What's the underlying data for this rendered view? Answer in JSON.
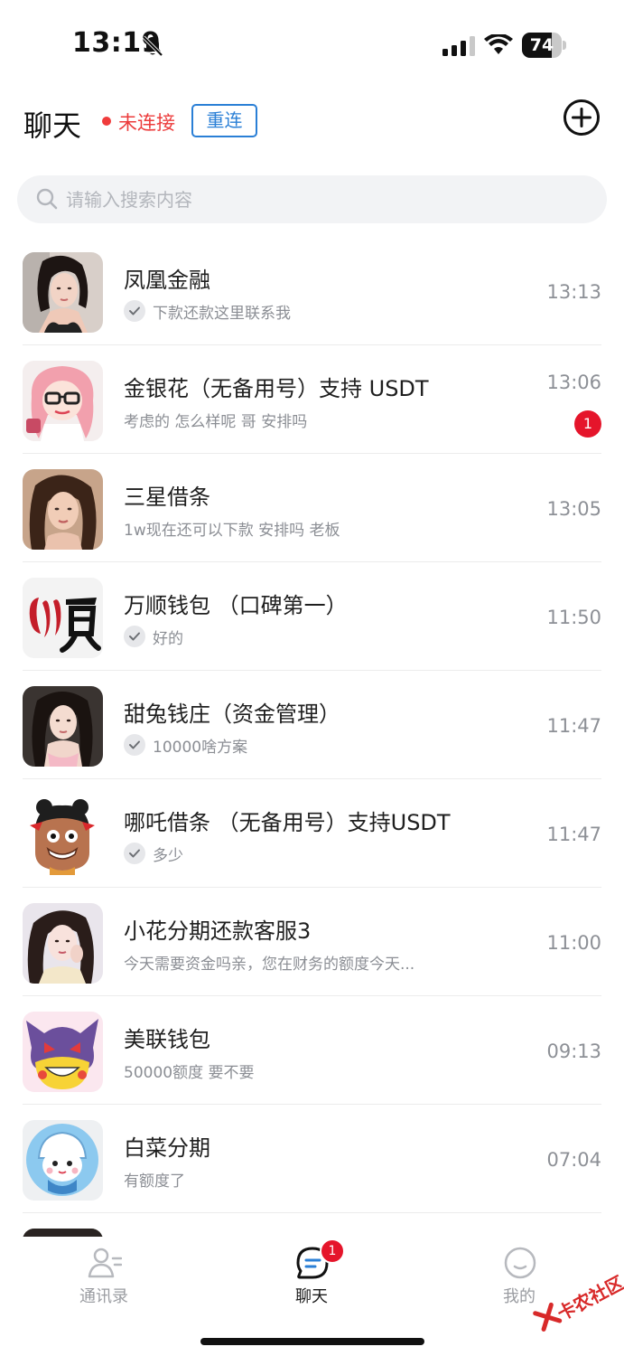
{
  "status_bar": {
    "time": "13:19",
    "battery": "74",
    "battery_level": 0.74,
    "icons": [
      "bell-off-icon",
      "signal-icon",
      "wifi-icon",
      "battery-icon"
    ]
  },
  "header": {
    "title": "聊天",
    "connection_status": "未连接",
    "reconnect_label": "重连",
    "add_icon": "plus-circle-icon"
  },
  "search": {
    "placeholder": "请输入搜索内容"
  },
  "chats": [
    {
      "name": "凤凰金融",
      "preview": "下款还款这里联系我",
      "time": "13:13",
      "read_check": true,
      "unread": ""
    },
    {
      "name": "金银花（无备用号）支持 USDT",
      "preview": "考虑的 怎么样呢 哥 安排吗",
      "time": "13:06",
      "read_check": false,
      "unread": "1"
    },
    {
      "name": "三星借条",
      "preview": "1w现在还可以下款 安排吗 老板",
      "time": "13:05",
      "read_check": false,
      "unread": ""
    },
    {
      "name": "万顺钱包 （口碑第一）",
      "preview": "好的",
      "time": "11:50",
      "read_check": true,
      "unread": ""
    },
    {
      "name": "甜兔钱庄（资金管理）",
      "preview": "10000啥方案",
      "time": "11:47",
      "read_check": true,
      "unread": ""
    },
    {
      "name": "哪吒借条 （无备用号）支持USDT",
      "preview": "多少",
      "time": "11:47",
      "read_check": true,
      "unread": ""
    },
    {
      "name": "小花分期还款客服3",
      "preview": "今天需要资金吗亲，您在财务的额度今天...",
      "time": "11:00",
      "read_check": false,
      "unread": ""
    },
    {
      "name": "美联钱包",
      "preview": "50000额度 要不要",
      "time": "09:13",
      "read_check": false,
      "unread": ""
    },
    {
      "name": "白菜分期",
      "preview": "有额度了",
      "time": "07:04",
      "read_check": false,
      "unread": ""
    }
  ],
  "avatar_text": {
    "wanshun_logo": "顺"
  },
  "tabs": [
    {
      "label": "通讯录",
      "icon": "contacts-icon",
      "active": false
    },
    {
      "label": "聊天",
      "icon": "chat-icon",
      "active": true,
      "badge": "1"
    },
    {
      "label": "我的",
      "icon": "profile-icon",
      "active": false
    }
  ],
  "watermark": "卡农社区",
  "colors": {
    "accent_blue": "#2a7fd6",
    "alert_red": "#ec3b3b",
    "badge_red": "#e5152b",
    "search_bg": "#f2f3f5"
  }
}
